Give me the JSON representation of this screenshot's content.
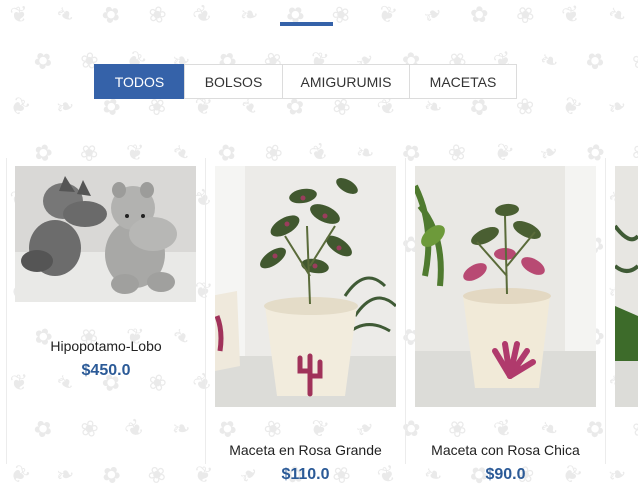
{
  "theme": {
    "accent": "#3562a9",
    "price_color": "#2b5a97"
  },
  "filters": [
    {
      "label": "TODOS",
      "active": true
    },
    {
      "label": "BOLSOS",
      "active": false
    },
    {
      "label": "AMIGURUMIS",
      "active": false
    },
    {
      "label": "MACETAS",
      "active": false
    }
  ],
  "products": [
    {
      "name": "Hipopotamo-Lobo",
      "price": "$450.0"
    },
    {
      "name": "Maceta en Rosa Grande",
      "price": "$110.0"
    },
    {
      "name": "Maceta con Rosa Chica",
      "price": "$90.0"
    }
  ]
}
